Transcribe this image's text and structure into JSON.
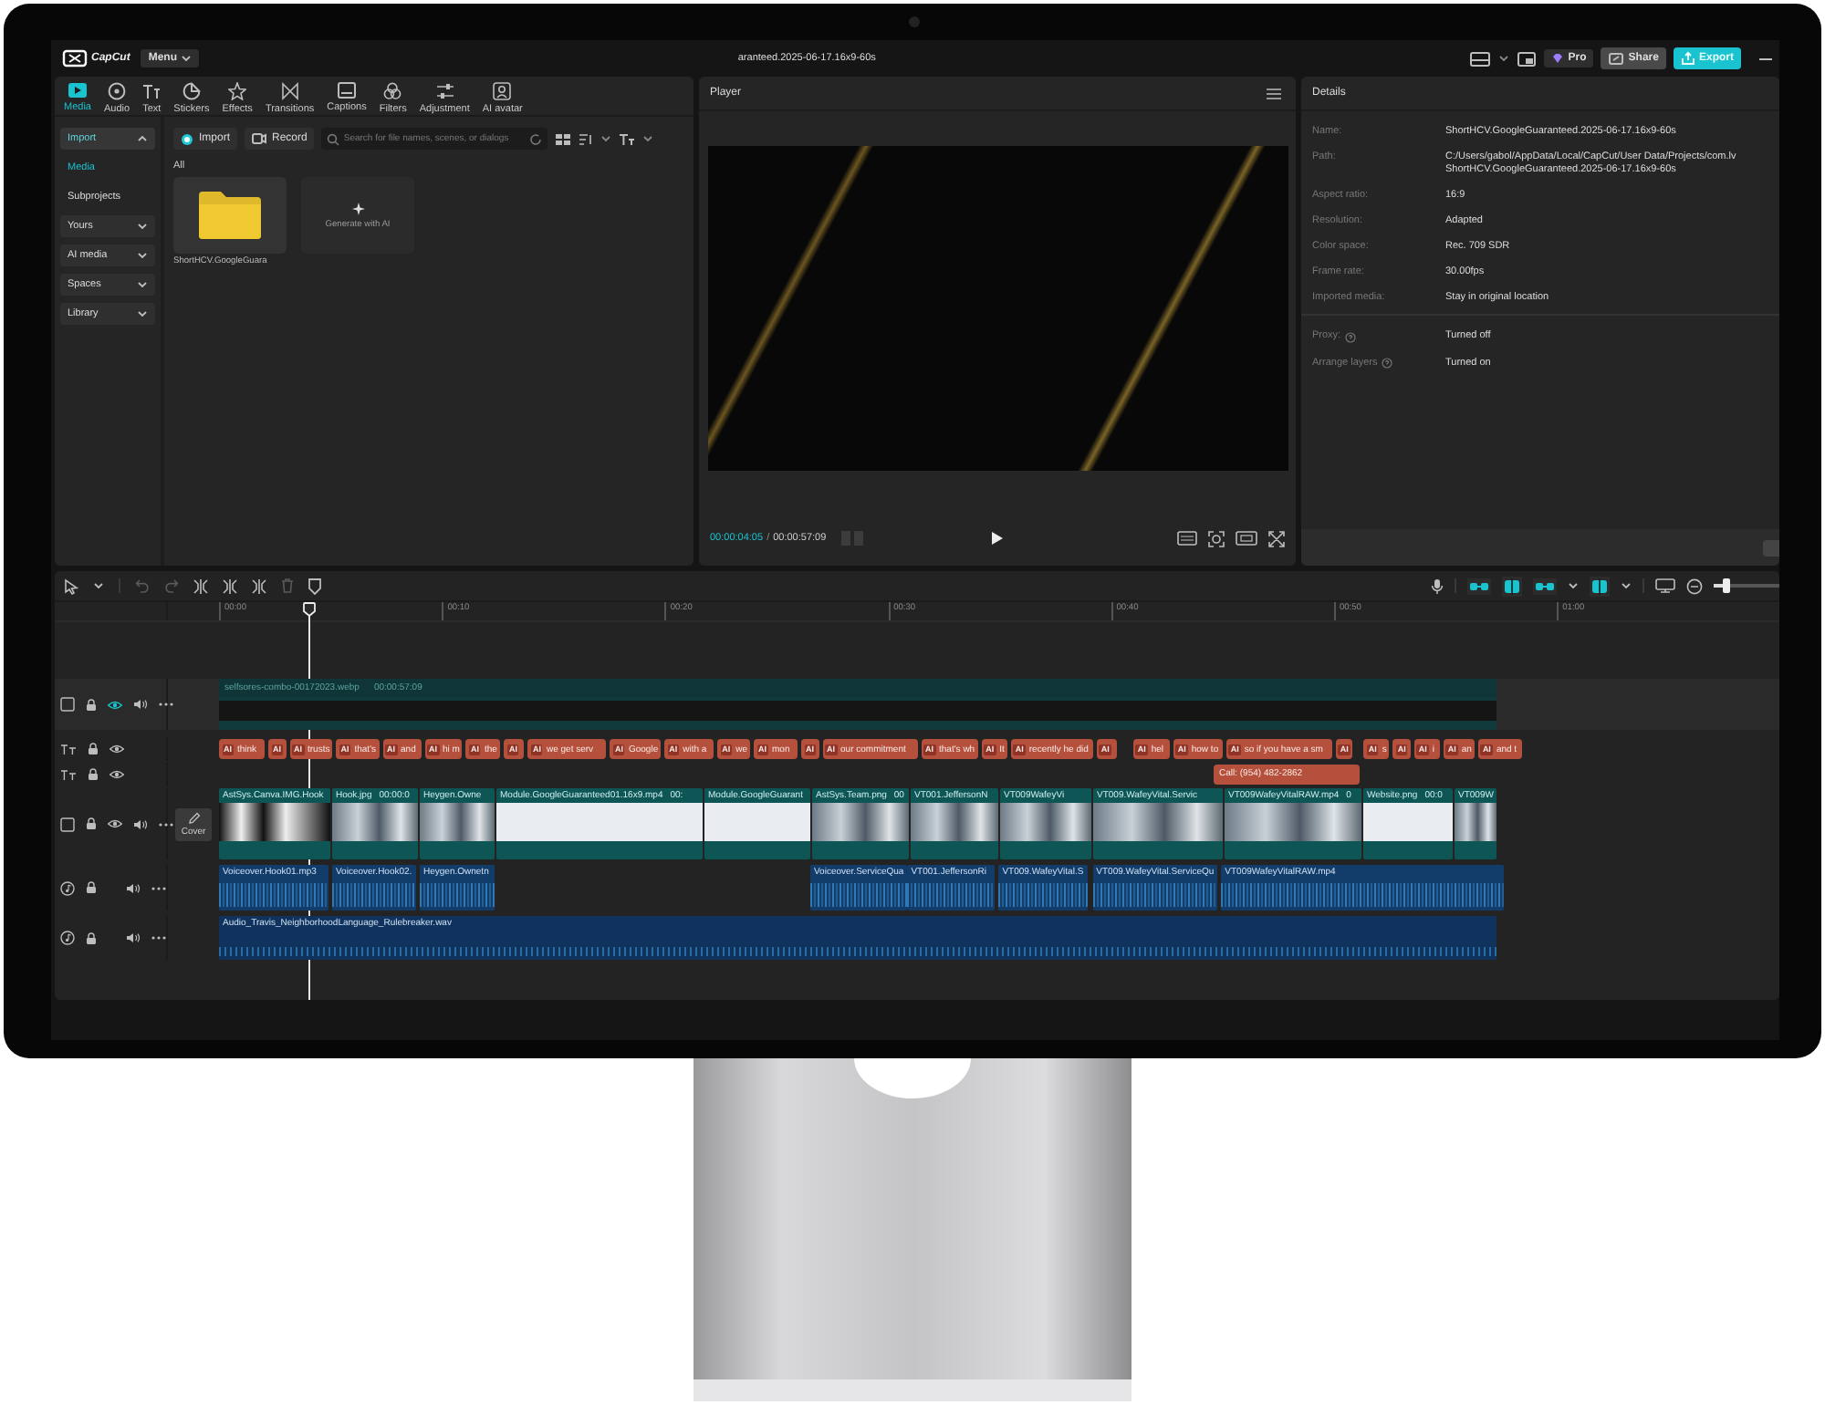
{
  "app_bar": {
    "logo": "CapCut",
    "menu": "Menu",
    "title": "aranteed.2025-06-17.16x9-60s",
    "buttons": [
      {
        "kind": "pro",
        "label": "Pro"
      },
      {
        "kind": "share",
        "label": "Share"
      },
      {
        "kind": "export",
        "label": "Export"
      }
    ]
  },
  "media_panel": {
    "tabs": [
      {
        "kind": "media",
        "label": "Media",
        "selected": true
      },
      {
        "kind": "audio",
        "label": "Audio",
        "selected": false
      },
      {
        "kind": "text",
        "label": "Text",
        "selected": false
      },
      {
        "kind": "stickers",
        "label": "Stickers",
        "selected": false
      },
      {
        "kind": "effects",
        "label": "Effects",
        "selected": false
      },
      {
        "kind": "transitions",
        "label": "Transitions",
        "selected": false
      },
      {
        "kind": "captions",
        "label": "Captions",
        "selected": false
      },
      {
        "kind": "filters",
        "label": "Filters",
        "selected": false
      },
      {
        "kind": "adjustment",
        "label": "Adjustment",
        "selected": false
      },
      {
        "kind": "avatar",
        "label": "AI avatar",
        "selected": false
      }
    ],
    "sidebar": [
      {
        "kind": "group",
        "label": "Import",
        "expanded": true,
        "selected": true
      },
      {
        "kind": "item",
        "label": "Media",
        "selected": true
      },
      {
        "kind": "item",
        "label": "Subprojects",
        "selected": false
      },
      {
        "kind": "group",
        "label": "Yours",
        "expanded": false,
        "selected": false
      },
      {
        "kind": "group",
        "label": "AI media",
        "expanded": false,
        "selected": false
      },
      {
        "kind": "group",
        "label": "Spaces",
        "expanded": false,
        "selected": false
      },
      {
        "kind": "group",
        "label": "Library",
        "expanded": false,
        "selected": false
      }
    ],
    "import_button": "Import",
    "record_button": "Record",
    "search": {
      "placeholder": "Search for file names, scenes, or dialogs"
    },
    "section_title": "All",
    "items": [
      {
        "kind": "folder",
        "label": "ShortHCV.GoogleGuara"
      },
      {
        "kind": "generate",
        "label": "Generate with AI"
      }
    ]
  },
  "player": {
    "title": "Player",
    "current_time": "00:00:04:05",
    "separator": "/",
    "duration": "00:00:57:09"
  },
  "details": {
    "title": "Details",
    "rows": [
      {
        "label": "Name:",
        "value": [
          "ShortHCV.GoogleGuaranteed.2025-06-17.16x9-60s"
        ]
      },
      {
        "label": "Path:",
        "value": [
          "C:/Users/gabol/AppData/Local/CapCut/User Data/Projects/com.lv",
          "ShortHCV.GoogleGuaranteed.2025-06-17.16x9-60s"
        ]
      },
      {
        "label": "Aspect ratio:",
        "value": [
          "16:9"
        ]
      },
      {
        "label": "Resolution:",
        "value": [
          "Adapted"
        ]
      },
      {
        "label": "Color space:",
        "value": [
          "Rec. 709 SDR"
        ]
      },
      {
        "label": "Frame rate:",
        "value": [
          "30.00fps"
        ]
      },
      {
        "label": "Imported media:",
        "value": [
          "Stay in original location"
        ]
      }
    ],
    "settings": [
      {
        "label": "Proxy:",
        "value": [
          "Turned off"
        ]
      },
      {
        "label": "Arrange layers",
        "value": [
          "Turned on"
        ]
      }
    ]
  },
  "timeline": {
    "ruler": [
      "00:00",
      "00:10",
      "00:20",
      "00:30",
      "00:40",
      "00:50",
      "01:00"
    ],
    "zoom": {
      "level": 0.2
    },
    "tracks": [
      {
        "kind": "overlay",
        "eye_active": true,
        "clips": [
          {
            "name": "selfsores-combo-00172023.webp",
            "duration": "00:00:57:09"
          }
        ]
      },
      {
        "kind": "caption",
        "eye_active": false,
        "clips": [
          {
            "badge": "AI",
            "text": "think"
          },
          {
            "badge": "AI"
          },
          {
            "badge": "AI",
            "text": "trusts"
          },
          {
            "badge": "AI",
            "text": "that's"
          },
          {
            "badge": "AI",
            "text": "and"
          },
          {
            "badge": "AI",
            "text": "hi m"
          },
          {
            "badge": "AI",
            "text": "the"
          },
          {
            "badge": "AI"
          },
          {
            "badge": "AI",
            "text": "we get serv"
          },
          {
            "badge": "AI",
            "text": "Google"
          },
          {
            "badge": "AI",
            "text": "with a"
          },
          {
            "badge": "AI",
            "text": "we"
          },
          {
            "badge": "AI",
            "text": "mon"
          },
          {
            "badge": "AI"
          },
          {
            "badge": "AI",
            "text": "our commitment"
          },
          {
            "badge": "AI",
            "text": "that's wh"
          },
          {
            "badge": "AI",
            "text": "It"
          },
          {
            "badge": "AI",
            "text": "recently he did"
          },
          {
            "badge": "AI"
          },
          {
            "badge": "AI",
            "text": "hel"
          },
          {
            "badge": "AI",
            "text": "how to"
          },
          {
            "badge": "AI",
            "text": "so if you have a sm"
          },
          {
            "badge": "AI"
          },
          {
            "badge": "AI",
            "text": "s"
          },
          {
            "badge": "AI"
          },
          {
            "badge": "AI",
            "text": "i"
          },
          {
            "badge": "AI",
            "text": "an"
          },
          {
            "badge": "AI",
            "text": "and t"
          }
        ]
      },
      {
        "kind": "text",
        "eye_active": false,
        "clips": [
          {
            "text": "Call: (954) 482-2862"
          }
        ]
      },
      {
        "kind": "video",
        "eye_active": false,
        "cover": "Cover",
        "clips": [
          {
            "name": "AstSys.Canva.IMG.Hook"
          },
          {
            "name": "Hook.jpg",
            "duration": "00:00:0"
          },
          {
            "name": "Heygen.Owne"
          },
          {
            "name": "Module.GoogleGuaranteed01.16x9.mp4",
            "duration": "00:"
          },
          {
            "name": "Module.GoogleGuarant"
          },
          {
            "name": "AstSys.Team.png",
            "duration": "00"
          },
          {
            "name": "VT001.JeffersonN"
          },
          {
            "name": "VT009WafeyVi"
          },
          {
            "name": "VT009.WafeyVital.Servic"
          },
          {
            "name": "VT009WafeyVitalRAW.mp4",
            "duration": "0"
          },
          {
            "name": "Website.png",
            "duration": "00:0"
          },
          {
            "name": "VT009W"
          }
        ]
      },
      {
        "kind": "audio",
        "clips": [
          {
            "name": "Voiceover.Hook01.mp3"
          },
          {
            "name": "Voiceover.Hook02."
          },
          {
            "name": "Heygen.Ownetn"
          },
          {
            "name": "Voiceover.ServiceQua"
          },
          {
            "name": "VT001.JeffersonRi"
          },
          {
            "name": "VT009.WafeyVital.S"
          },
          {
            "name": "VT009.WafeyVital.ServiceQu"
          },
          {
            "name": "VT009WafeyVitalRAW.mp4"
          }
        ]
      },
      {
        "kind": "music",
        "clips": [
          {
            "name": "Audio_Travis_NeighborhoodLanguage_Rulebreaker.wav"
          }
        ]
      }
    ]
  }
}
